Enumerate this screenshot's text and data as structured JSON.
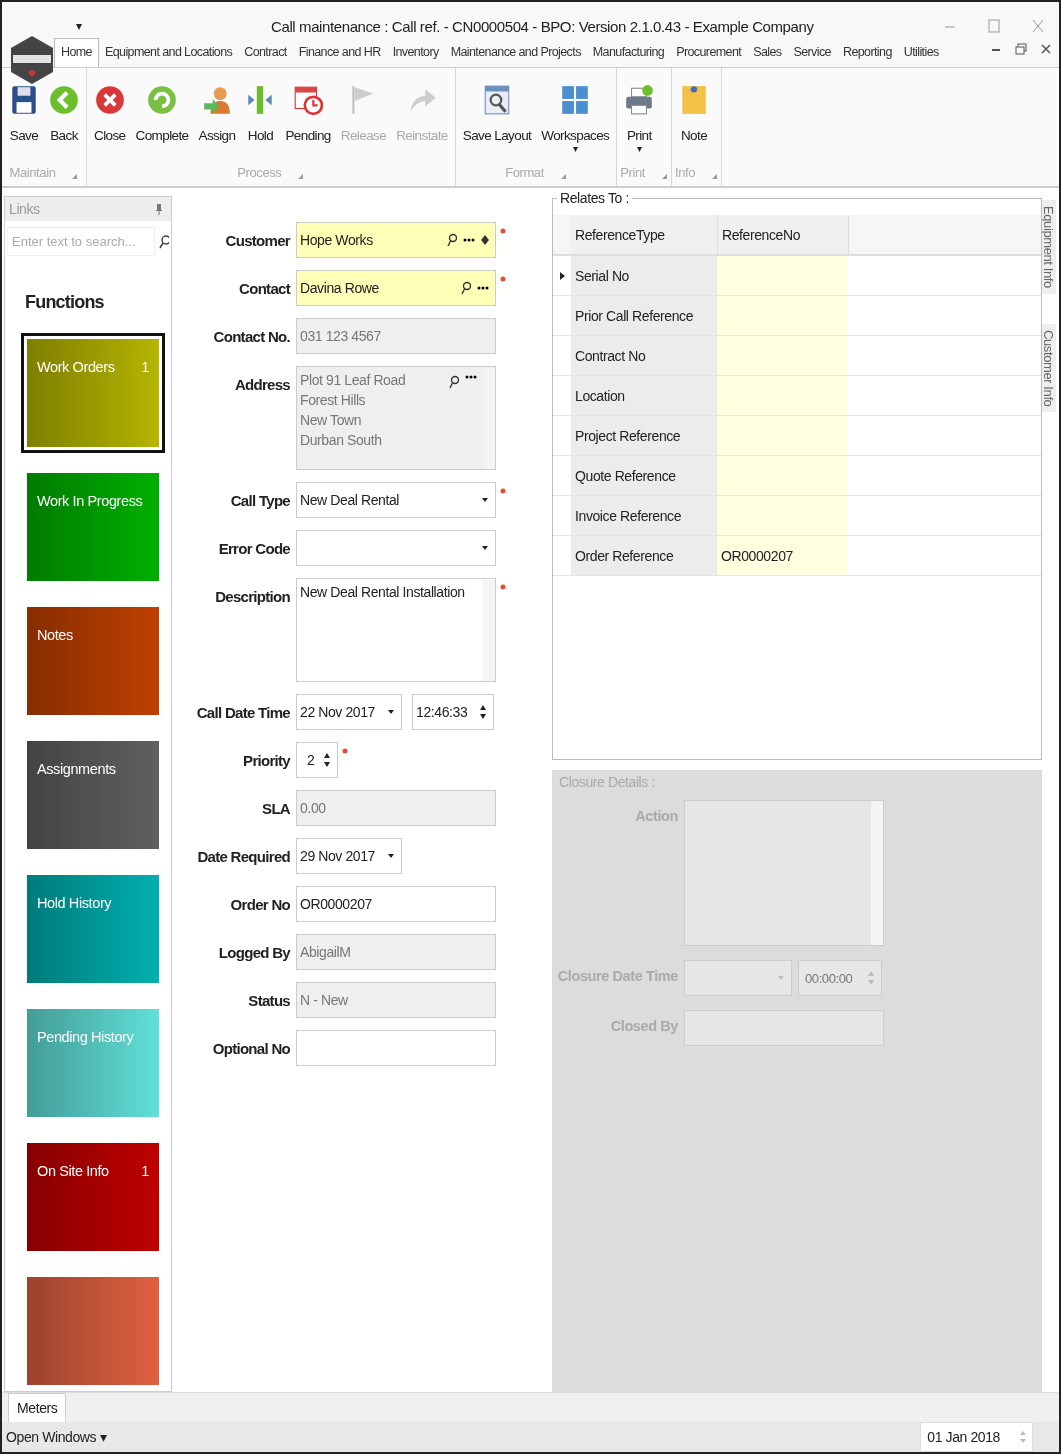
{
  "window": {
    "title": "Call maintenance : Call ref. - CN0000504 - BPO: Version 2.1.0.43 - Example Company",
    "quick_access": "▾"
  },
  "ribbon_tabs": [
    {
      "label": "Home",
      "selected": true
    },
    {
      "label": "Equipment and Locations",
      "selected": false
    },
    {
      "label": "Contract",
      "selected": false
    },
    {
      "label": "Finance and HR",
      "selected": false
    },
    {
      "label": "Inventory",
      "selected": false
    },
    {
      "label": "Maintenance and Projects",
      "selected": false
    },
    {
      "label": "Manufacturing",
      "selected": false
    },
    {
      "label": "Procurement",
      "selected": false
    },
    {
      "label": "Sales",
      "selected": false
    },
    {
      "label": "Service",
      "selected": false
    },
    {
      "label": "Reporting",
      "selected": false
    },
    {
      "label": "Utilities",
      "selected": false
    }
  ],
  "ribbon_groups": [
    {
      "label": "Maintain",
      "buttons": [
        {
          "label": "Save",
          "disabled": false
        },
        {
          "label": "Back",
          "disabled": false
        }
      ]
    },
    {
      "label": "Process",
      "buttons": [
        {
          "label": "Close",
          "disabled": false
        },
        {
          "label": "Complete",
          "disabled": false
        },
        {
          "label": "Assign",
          "disabled": false
        },
        {
          "label": "Hold",
          "disabled": false
        },
        {
          "label": "Pending",
          "disabled": false
        },
        {
          "label": "Release",
          "disabled": true
        },
        {
          "label": "Reinstate",
          "disabled": true
        }
      ]
    },
    {
      "label": "Format",
      "buttons": [
        {
          "label": "Save Layout",
          "disabled": false
        },
        {
          "label": "Workspaces",
          "disabled": false,
          "dropdown": "▾"
        }
      ]
    },
    {
      "label": "Print",
      "buttons": [
        {
          "label": "Print",
          "disabled": false,
          "dropdown": "▾"
        }
      ]
    },
    {
      "label": "Info",
      "buttons": [
        {
          "label": "Note",
          "disabled": false
        }
      ]
    }
  ],
  "links": {
    "title": "Links",
    "search": {
      "placeholder": "Enter text to search..."
    },
    "heading": "Functions",
    "tiles": [
      {
        "label": "Work Orders",
        "count": "1",
        "color": "#b5b500",
        "selected": true
      },
      {
        "label": "Work In Progress",
        "color": "#00b000",
        "selected": false
      },
      {
        "label": "Notes",
        "color": "#c04000",
        "selected": false
      },
      {
        "label": "Assignments",
        "color": "#606060",
        "selected": false
      },
      {
        "label": "Hold History",
        "color": "#00b0b0",
        "selected": false
      },
      {
        "label": "Pending History",
        "color": "#60e0d8",
        "selected": false
      },
      {
        "label": "On Site Info",
        "count": "1",
        "color": "#c00000",
        "selected": false
      },
      {
        "color": "#e06040",
        "selected": false
      }
    ]
  },
  "form": [
    {
      "label": "Customer",
      "kind": "lookup",
      "value": "Hope Works",
      "required": true,
      "clear": true
    },
    {
      "label": "Contact",
      "kind": "lookup",
      "value": "Davina Rowe",
      "required": true
    },
    {
      "label": "Contact No.",
      "kind": "readonly",
      "value": "031 123 4567"
    },
    {
      "label": "Address",
      "kind": "address",
      "lines": [
        "Plot 91 Leaf Road",
        "Forest Hills",
        "New Town",
        "Durban South"
      ]
    },
    {
      "label": "Call Type",
      "kind": "combo",
      "value": "New Deal Rental",
      "required": true
    },
    {
      "label": "Error Code",
      "kind": "combo"
    },
    {
      "label": "Description",
      "kind": "memo",
      "value": "New Deal Rental Installation",
      "required": true
    },
    {
      "label": "Call Date Time",
      "kind": "datetime",
      "value": "22 Nov 2017",
      "time": "12:46:33"
    },
    {
      "label": "Priority",
      "kind": "spin",
      "value": "2",
      "required": true
    },
    {
      "label": "SLA",
      "kind": "readonly",
      "value": "0.00"
    },
    {
      "label": "Date Required",
      "kind": "date",
      "value": "29 Nov 2017"
    },
    {
      "label": "Order No",
      "kind": "text",
      "value": "OR0000207"
    },
    {
      "label": "Logged By",
      "kind": "readonly",
      "value": "AbigailM"
    },
    {
      "label": "Status",
      "kind": "readonly",
      "value": "N - New"
    },
    {
      "label": "Optional No",
      "kind": "text"
    }
  ],
  "relates_to": {
    "title": "Relates To :",
    "columns": [
      "ReferenceType",
      "ReferenceNo"
    ],
    "rows": [
      {
        "type": "Serial No",
        "selected": true
      },
      {
        "type": "Prior Call Reference",
        "selected": false
      },
      {
        "type": "Contract No",
        "selected": false
      },
      {
        "type": "Location",
        "selected": false
      },
      {
        "type": "Project Reference",
        "selected": false
      },
      {
        "type": "Quote Reference",
        "selected": false
      },
      {
        "type": "Invoice Reference",
        "selected": false
      },
      {
        "type": "Order Reference",
        "no": "OR0000207",
        "selected": false
      }
    ]
  },
  "closure": {
    "title": "Closure Details :",
    "action_label": "Action",
    "date_label": "Closure Date Time",
    "time": "00:00:00",
    "closed_by_label": "Closed By"
  },
  "side_tabs": [
    "Equipment Info",
    "Customer Info"
  ],
  "bottom_tabs": [
    {
      "label": "Meters",
      "selected": true
    }
  ],
  "status_bar": {
    "open_windows": "Open Windows ▾",
    "date": "01 Jan 2018"
  }
}
